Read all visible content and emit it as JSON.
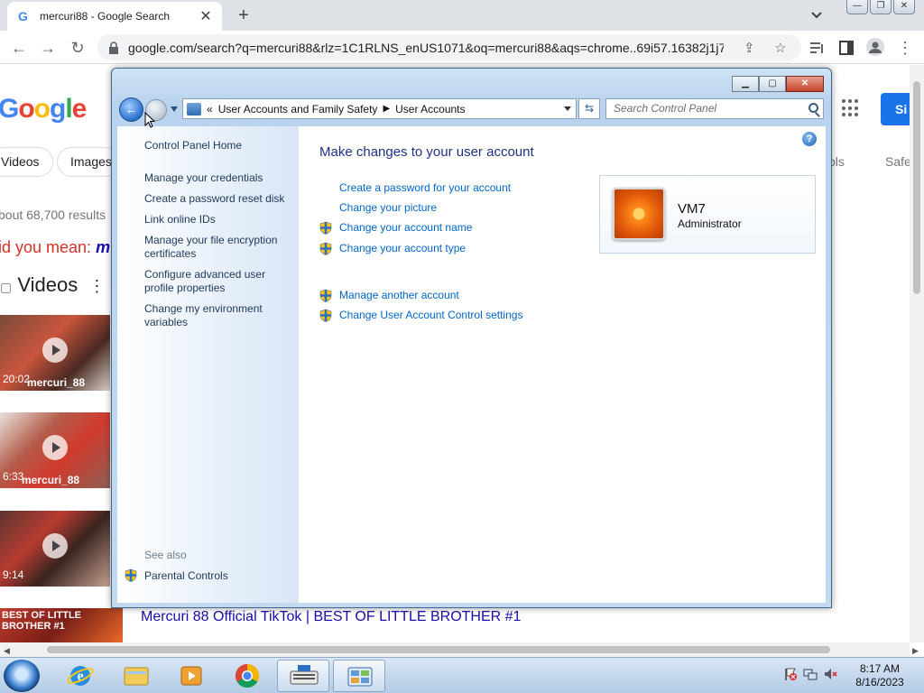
{
  "browser": {
    "tab_title": "mercuri88 - Google Search",
    "url": "google.com/search?q=mercuri88&rlz=1C1RLNS_enUS1071&oq=mercuri88&aqs=chrome..69i57.16382j1j7..."
  },
  "google": {
    "pill_videos": "Videos",
    "pill_images": "Images",
    "pill_tools": "ols",
    "pill_safe": "Safe",
    "results_count": "bout 68,700 results",
    "did_you_mean": "id you mean:",
    "did_you_mean_term": "m",
    "videos_heading": "Videos",
    "thumbs": [
      {
        "duration": "20:02",
        "caption": "mercuri_88"
      },
      {
        "duration": "6:33",
        "caption": "mercuri_88"
      },
      {
        "duration": "9:14",
        "caption": ""
      },
      {
        "duration": "",
        "caption": "BEST OF LITTLE BROTHER #1"
      }
    ],
    "result_link": "Mercuri 88 Official TikTok | BEST OF LITTLE BROTHER #1",
    "signin_label": "Si"
  },
  "control_panel": {
    "breadcrumb": [
      "User Accounts and Family Safety",
      "User Accounts"
    ],
    "breadcrumb_prefix": "«",
    "search_placeholder": "Search Control Panel",
    "left_links": [
      "Control Panel Home",
      "Manage your credentials",
      "Create a password reset disk",
      "Link online IDs",
      "Manage your file encryption certificates",
      "Configure advanced user profile properties",
      "Change my environment variables"
    ],
    "see_also": "See also",
    "parental_controls": "Parental Controls",
    "heading": "Make changes to your user account",
    "tasks": [
      "Create a password for your account",
      "Change your picture",
      "Change your account name",
      "Change your account type",
      "Manage another account",
      "Change User Account Control settings"
    ],
    "user": {
      "name": "VM7",
      "role": "Administrator"
    }
  },
  "taskbar": {
    "time": "8:17 AM",
    "date": "8/16/2023"
  }
}
